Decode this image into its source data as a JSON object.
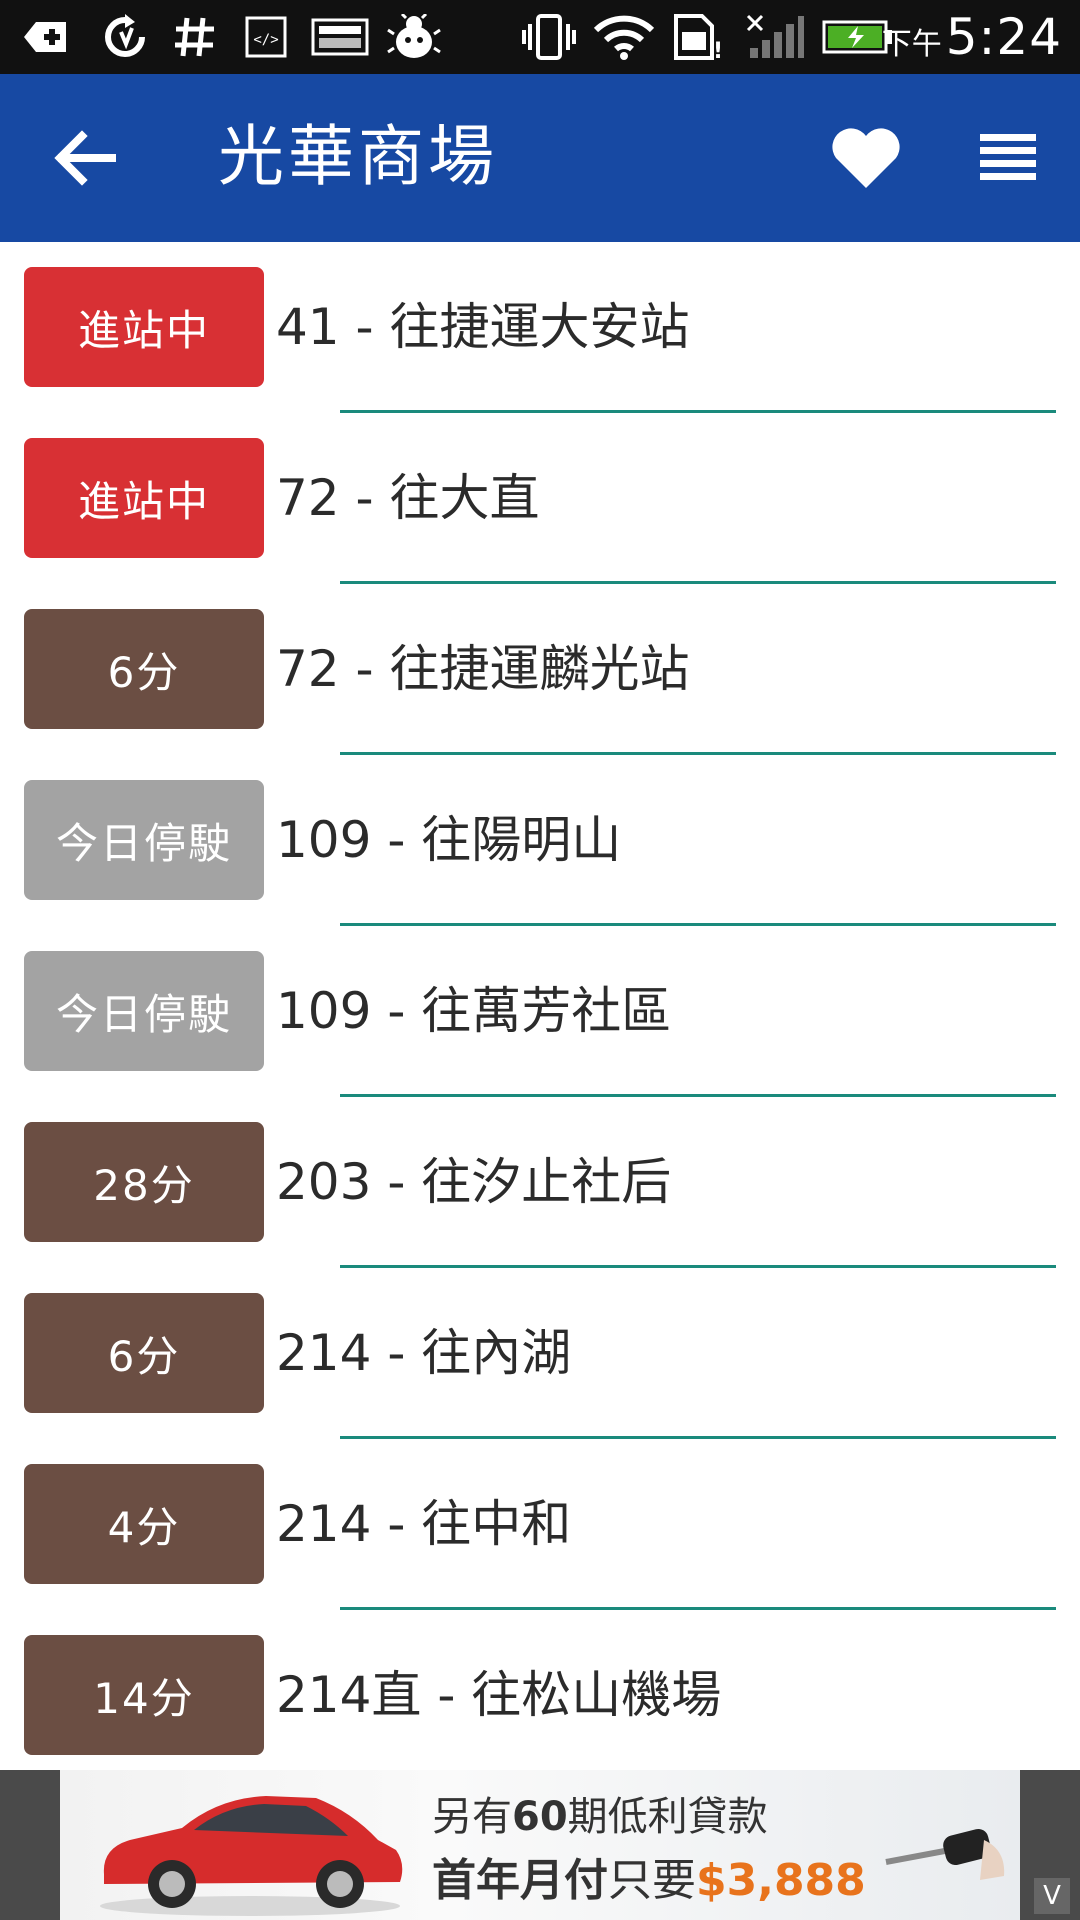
{
  "status_bar": {
    "ampm": "下午",
    "time": "5:24",
    "icons": [
      "add-icon",
      "sync-icon",
      "hash-icon",
      "code-icon",
      "image-icon",
      "bug-icon",
      "vibrate-icon",
      "wifi-icon",
      "sim-icon",
      "no-signal-icon",
      "battery-charging-icon"
    ]
  },
  "app_bar": {
    "title": "光華商場",
    "back_icon": "arrow-left-icon",
    "favorite_icon": "heart-icon",
    "menu_icon": "menu-icon"
  },
  "colors": {
    "app_bar": "#1749a3",
    "arriving": "#d83034",
    "minutes": "#6b4e43",
    "not_running": "#a3a3a3",
    "accent_line": "#1a8a7c",
    "ad_price": "#e8731c"
  },
  "routes": [
    {
      "status": "進站中",
      "status_type": "arriving",
      "route": "41 - 往捷運大安站"
    },
    {
      "status": "進站中",
      "status_type": "arriving",
      "route": "72 - 往大直"
    },
    {
      "status": "6分",
      "status_type": "minutes",
      "route": "72 - 往捷運麟光站"
    },
    {
      "status": "今日停駛",
      "status_type": "not_running",
      "route": "109 - 往陽明山"
    },
    {
      "status": "今日停駛",
      "status_type": "not_running",
      "route": "109 - 往萬芳社區"
    },
    {
      "status": "28分",
      "status_type": "minutes",
      "route": "203 - 往汐止社后"
    },
    {
      "status": "6分",
      "status_type": "minutes",
      "route": "214 - 往內湖"
    },
    {
      "status": "4分",
      "status_type": "minutes",
      "route": "214 - 往中和"
    },
    {
      "status": "14分",
      "status_type": "minutes",
      "route": "214直 - 往松山機場"
    }
  ],
  "ad": {
    "line1_prefix": "另有",
    "line1_emph": "60",
    "line1_suffix": "期低利貸款",
    "line2_prefix": "首年月付",
    "line2_mid": "只要",
    "line2_price": "$3,888",
    "corner_label": "V"
  }
}
